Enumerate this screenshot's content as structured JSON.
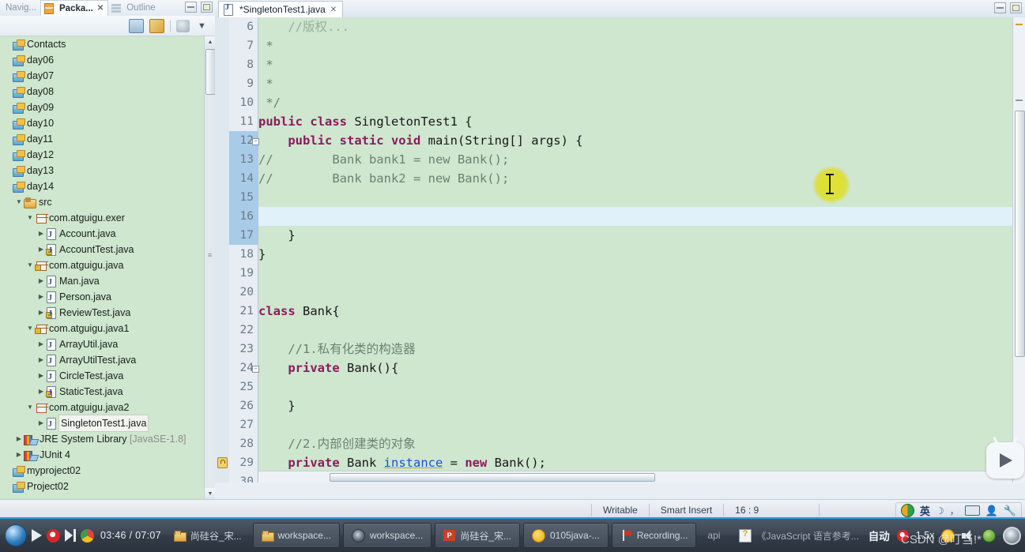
{
  "window": {
    "left_tabs": [
      {
        "label": "Navig...",
        "icon": "navigator-icon",
        "active": false
      },
      {
        "label": "Packa...",
        "icon": "package-explorer-icon",
        "active": true,
        "closable": true
      },
      {
        "label": "Outline",
        "icon": "outline-icon",
        "active": false
      }
    ],
    "minimize_label": "Minimize",
    "maximize_label": "Maximize"
  },
  "view_toolbar": {
    "icons": [
      "collapse-all-icon",
      "link-with-editor-icon",
      "view-menu-icon",
      "view-dropdown-icon"
    ]
  },
  "tree": {
    "items": [
      {
        "label": "Contacts",
        "indent": 0,
        "icon": "project-icon",
        "twisty": "",
        "selected": false
      },
      {
        "label": "day06",
        "indent": 0,
        "icon": "project-icon",
        "twisty": "",
        "selected": false
      },
      {
        "label": "day07",
        "indent": 0,
        "icon": "project-icon",
        "twisty": "",
        "selected": false
      },
      {
        "label": "day08",
        "indent": 0,
        "icon": "project-icon",
        "twisty": "",
        "selected": false
      },
      {
        "label": "day09",
        "indent": 0,
        "icon": "project-icon",
        "twisty": "",
        "selected": false
      },
      {
        "label": "day10",
        "indent": 0,
        "icon": "project-icon",
        "twisty": "",
        "selected": false
      },
      {
        "label": "day11",
        "indent": 0,
        "icon": "project-icon",
        "twisty": "",
        "selected": false
      },
      {
        "label": "day12",
        "indent": 0,
        "icon": "project-icon",
        "twisty": "",
        "selected": false
      },
      {
        "label": "day13",
        "indent": 0,
        "icon": "project-icon",
        "twisty": "",
        "selected": false
      },
      {
        "label": "day14",
        "indent": 0,
        "icon": "project-icon",
        "twisty": "",
        "selected": false
      },
      {
        "label": "src",
        "indent": 1,
        "icon": "source-folder-icon",
        "twisty": "▼",
        "selected": false
      },
      {
        "label": "com.atguigu.exer",
        "indent": 2,
        "icon": "package-icon",
        "twisty": "▼",
        "selected": false
      },
      {
        "label": "Account.java",
        "indent": 3,
        "icon": "java-file-icon",
        "twisty": "▶",
        "selected": false
      },
      {
        "label": "AccountTest.java",
        "indent": 3,
        "icon": "java-file-lock-icon",
        "twisty": "▶",
        "selected": false
      },
      {
        "label": "com.atguigu.java",
        "indent": 2,
        "icon": "package-lock-icon",
        "twisty": "▼",
        "selected": false
      },
      {
        "label": "Man.java",
        "indent": 3,
        "icon": "java-file-icon",
        "twisty": "▶",
        "selected": false
      },
      {
        "label": "Person.java",
        "indent": 3,
        "icon": "java-file-icon",
        "twisty": "▶",
        "selected": false
      },
      {
        "label": "ReviewTest.java",
        "indent": 3,
        "icon": "java-file-lock-icon",
        "twisty": "▶",
        "selected": false
      },
      {
        "label": "com.atguigu.java1",
        "indent": 2,
        "icon": "package-lock-icon",
        "twisty": "▼",
        "selected": false
      },
      {
        "label": "ArrayUtil.java",
        "indent": 3,
        "icon": "java-file-icon",
        "twisty": "▶",
        "selected": false
      },
      {
        "label": "ArrayUtilTest.java",
        "indent": 3,
        "icon": "java-file-icon",
        "twisty": "▶",
        "selected": false
      },
      {
        "label": "CircleTest.java",
        "indent": 3,
        "icon": "java-file-icon",
        "twisty": "▶",
        "selected": false
      },
      {
        "label": "StaticTest.java",
        "indent": 3,
        "icon": "java-file-lock-icon",
        "twisty": "▶",
        "selected": false
      },
      {
        "label": "com.atguigu.java2",
        "indent": 2,
        "icon": "package-icon",
        "twisty": "▼",
        "selected": false
      },
      {
        "label": "SingletonTest1.java",
        "indent": 3,
        "icon": "java-file-icon",
        "twisty": "▶",
        "selected": true
      },
      {
        "label": "JRE System Library",
        "suffix": "[JavaSE-1.8]",
        "indent": 1,
        "icon": "library-icon",
        "twisty": "▶",
        "selected": false
      },
      {
        "label": "JUnit 4",
        "indent": 1,
        "icon": "library-icon",
        "twisty": "▶",
        "selected": false
      },
      {
        "label": "myproject02",
        "indent": 0,
        "icon": "project-icon",
        "twisty": "",
        "selected": false
      },
      {
        "label": "Project02",
        "indent": 0,
        "icon": "project-icon",
        "twisty": "",
        "selected": false
      }
    ]
  },
  "editor": {
    "tab_label": "*SingletonTest1.java",
    "tab_icon": "java-file-icon",
    "tab_close_label": "Close",
    "first_visible_line": 6,
    "lines": [
      {
        "num": 6,
        "tokens": [
          {
            "t": "    //版权...",
            "c": "cmt"
          }
        ],
        "clipped": true
      },
      {
        "num": 7,
        "tokens": [
          {
            "t": " *",
            "c": "cmt"
          }
        ]
      },
      {
        "num": 8,
        "tokens": [
          {
            "t": " *",
            "c": "cmt"
          }
        ]
      },
      {
        "num": 9,
        "tokens": [
          {
            "t": " *",
            "c": "cmt"
          }
        ]
      },
      {
        "num": 10,
        "tokens": [
          {
            "t": " */",
            "c": "cmt"
          }
        ]
      },
      {
        "num": 11,
        "tokens": [
          {
            "t": "public class ",
            "c": "kw"
          },
          {
            "t": "SingletonTest1 {",
            "c": "cls"
          }
        ]
      },
      {
        "num": 12,
        "tokens": [
          {
            "t": "    ",
            "c": ""
          },
          {
            "t": "public static void ",
            "c": "kw"
          },
          {
            "t": "main(String[] args) {",
            "c": "cls"
          }
        ],
        "fold": true,
        "cursor_gutter": true
      },
      {
        "num": 13,
        "tokens": [
          {
            "t": "//        Bank bank1 = new Bank();",
            "c": "cmt"
          }
        ],
        "cursor_gutter": true
      },
      {
        "num": 14,
        "tokens": [
          {
            "t": "//        Bank bank2 = new Bank();",
            "c": "cmt"
          }
        ],
        "cursor_gutter": true
      },
      {
        "num": 15,
        "tokens": [
          {
            "t": "",
            "c": ""
          }
        ],
        "cursor_gutter": true
      },
      {
        "num": 16,
        "tokens": [
          {
            "t": "        ",
            "c": ""
          }
        ],
        "highlight": true,
        "cursor_gutter": true
      },
      {
        "num": 17,
        "tokens": [
          {
            "t": "    }",
            "c": "cls"
          }
        ],
        "cursor_gutter": true
      },
      {
        "num": 18,
        "tokens": [
          {
            "t": "}",
            "c": "cls"
          }
        ]
      },
      {
        "num": 19,
        "tokens": [
          {
            "t": "",
            "c": ""
          }
        ]
      },
      {
        "num": 20,
        "tokens": [
          {
            "t": "",
            "c": ""
          }
        ]
      },
      {
        "num": 21,
        "tokens": [
          {
            "t": "class ",
            "c": "kw"
          },
          {
            "t": "Bank{",
            "c": "cls"
          }
        ]
      },
      {
        "num": 22,
        "tokens": [
          {
            "t": "",
            "c": ""
          }
        ]
      },
      {
        "num": 23,
        "tokens": [
          {
            "t": "    //1.私有化类的构造器",
            "c": "cmt"
          }
        ]
      },
      {
        "num": 24,
        "tokens": [
          {
            "t": "    ",
            "c": ""
          },
          {
            "t": "private ",
            "c": "kw"
          },
          {
            "t": "Bank(){",
            "c": "cls"
          }
        ],
        "fold": true
      },
      {
        "num": 25,
        "tokens": [
          {
            "t": "",
            "c": ""
          }
        ]
      },
      {
        "num": 26,
        "tokens": [
          {
            "t": "    }",
            "c": "cls"
          }
        ]
      },
      {
        "num": 27,
        "tokens": [
          {
            "t": "",
            "c": ""
          }
        ]
      },
      {
        "num": 28,
        "tokens": [
          {
            "t": "    //2.内部创建类的对象",
            "c": "cmt"
          }
        ]
      },
      {
        "num": 29,
        "tokens": [
          {
            "t": "    ",
            "c": ""
          },
          {
            "t": "private ",
            "c": "kw"
          },
          {
            "t": "Bank ",
            "c": "cls"
          },
          {
            "t": "instance",
            "c": "fld"
          },
          {
            "t": " = ",
            "c": "cls"
          },
          {
            "t": "new ",
            "c": "kw"
          },
          {
            "t": "Bank();",
            "c": "cls"
          }
        ],
        "warning": true
      },
      {
        "num": 30,
        "tokens": [
          {
            "t": "",
            "c": ""
          }
        ]
      }
    ]
  },
  "statusbar": {
    "writable": "Writable",
    "insert_mode": "Smart Insert",
    "position": "16 : 9",
    "ime": {
      "logo": "sogou-logo-icon",
      "mode": "英",
      "icons": [
        "moon-icon",
        "punctuation-icon",
        "keyboard-icon",
        "user-icon",
        "toolbox-icon"
      ]
    }
  },
  "taskbar": {
    "start_label": "Start",
    "player": {
      "play_label": "Play",
      "next_label": "Next",
      "current_time": "03:46",
      "separator": "/",
      "total_time": "07:07"
    },
    "buttons": [
      {
        "label": "尚硅谷_宋...",
        "icon": "folder-icon",
        "flat": true
      },
      {
        "label": "workspace...",
        "icon": "folder-icon",
        "flat": false
      },
      {
        "label": "workspace...",
        "icon": "gear-icon",
        "flat": false
      },
      {
        "label": "尚硅谷_宋...",
        "icon": "powerpoint-icon",
        "flat": false
      },
      {
        "label": "0105java-...",
        "icon": "qq-icon",
        "flat": false
      },
      {
        "label": "Recording...",
        "icon": "recorder-icon",
        "flat": false
      },
      {
        "label": "api",
        "icon": "",
        "flat": true
      },
      {
        "label": "《JavaScript 语言参考...",
        "icon": "help-icon",
        "flat": true
      }
    ],
    "right_controls": {
      "auto_label": "自动",
      "speed_label": "1.5x",
      "icons": [
        "volume-icon",
        "settings-gear-icon",
        "cast-icon",
        "embed-code-icon",
        "fullscreen-icon"
      ]
    }
  },
  "watermark": "CSDN @叮当!*"
}
